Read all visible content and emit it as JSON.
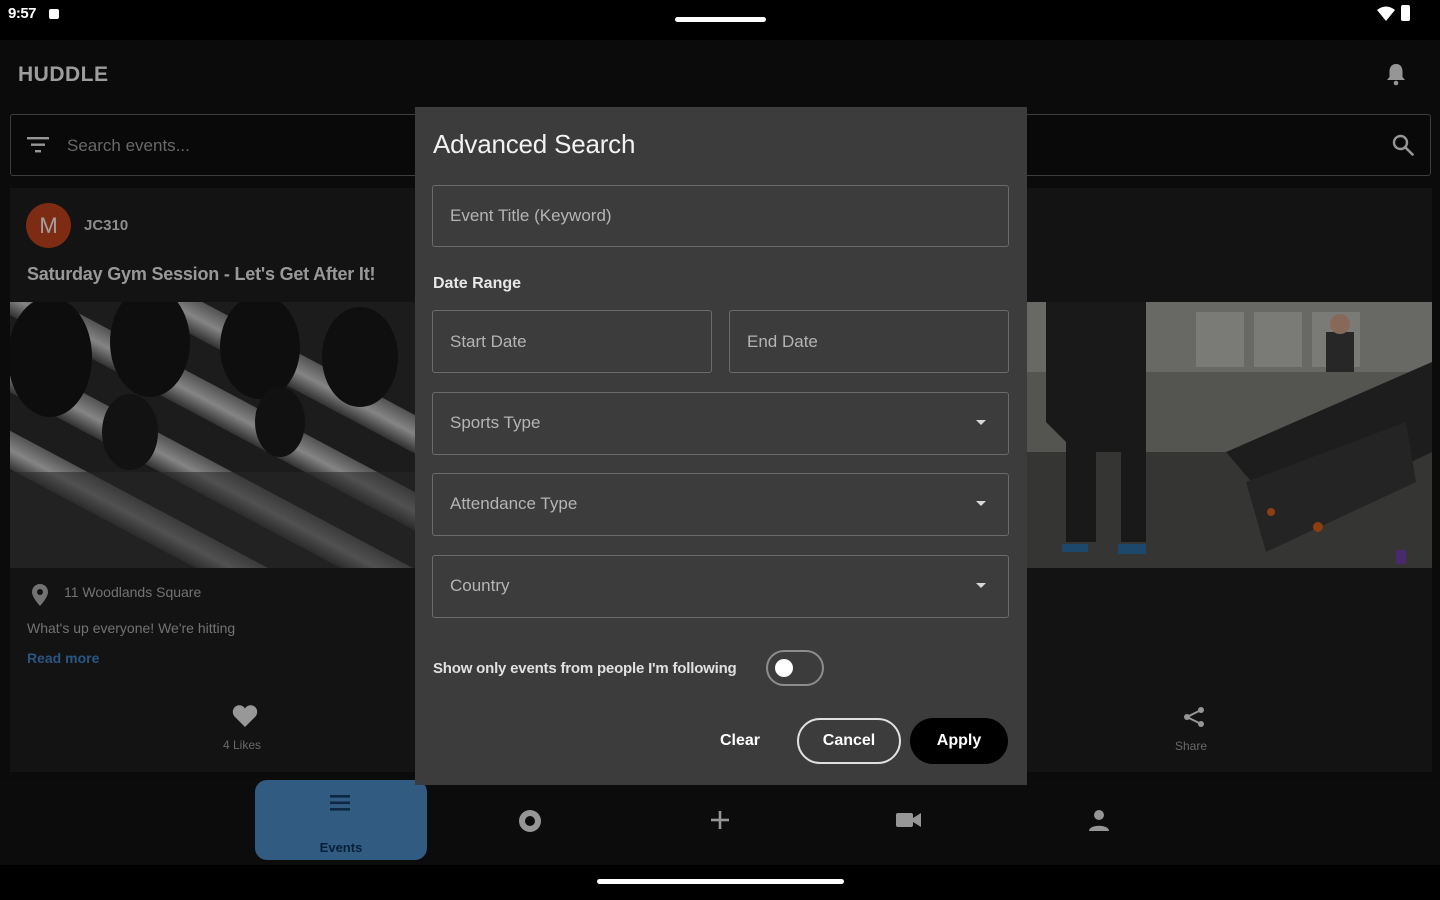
{
  "status_bar": {
    "time": "9:57"
  },
  "app_bar": {
    "title": "HUDDLE"
  },
  "search": {
    "placeholder": "Search events..."
  },
  "event_card": {
    "avatar_initial": "M",
    "username": "JC310",
    "title": "Saturday Gym Session - Let's Get After It!",
    "location": "11 Woodlands Square",
    "description": "What's up everyone! We're hitting",
    "read_more": "Read more",
    "likes": "4 Likes",
    "share": "Share"
  },
  "dialog": {
    "title": "Advanced Search",
    "keyword_placeholder": "Event Title (Keyword)",
    "date_range_label": "Date Range",
    "start_date_placeholder": "Start Date",
    "end_date_placeholder": "End Date",
    "sports_type_label": "Sports Type",
    "attendance_type_label": "Attendance Type",
    "country_label": "Country",
    "following_toggle_label": "Show only events from people I'm following",
    "following_toggle_on": false,
    "clear_label": "Clear",
    "cancel_label": "Cancel",
    "apply_label": "Apply"
  },
  "bottom_nav": {
    "items": [
      {
        "label": "Events",
        "icon": "list-icon",
        "selected": true
      },
      {
        "label": "",
        "icon": "record-icon",
        "selected": false
      },
      {
        "label": "",
        "icon": "plus-icon",
        "selected": false
      },
      {
        "label": "",
        "icon": "video-camera-icon",
        "selected": false
      },
      {
        "label": "",
        "icon": "person-icon",
        "selected": false
      }
    ]
  },
  "colors": {
    "accent_blue": "#4a86c0",
    "link_blue": "#3d7fc1",
    "avatar_orange": "#b8421c",
    "dialog_bg": "#3c3c3c"
  }
}
